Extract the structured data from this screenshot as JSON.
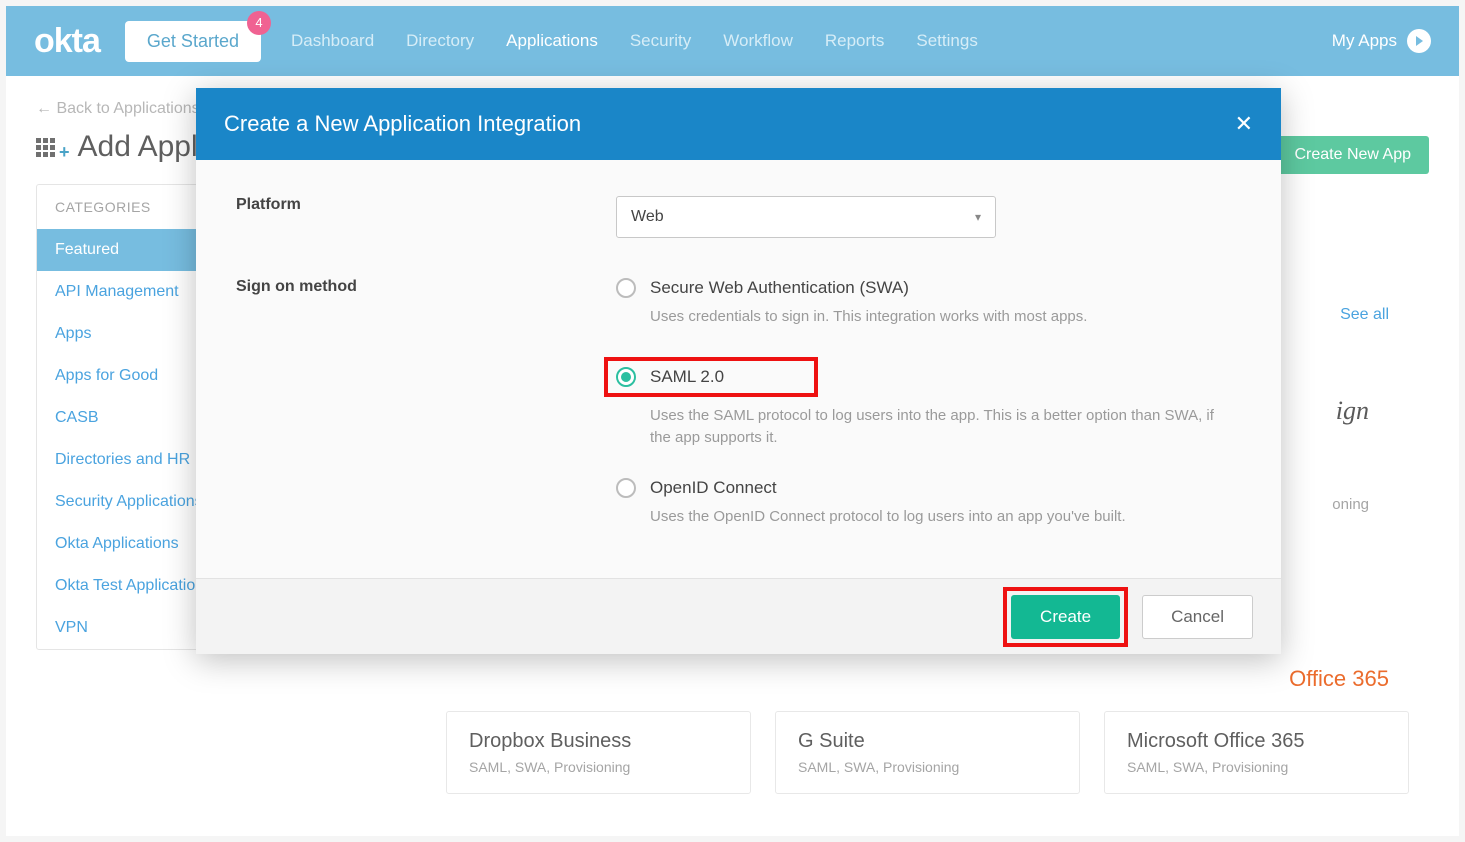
{
  "brand": "okta",
  "nav": {
    "getStarted": "Get Started",
    "badge": "4",
    "items": [
      "Dashboard",
      "Directory",
      "Applications",
      "Security",
      "Workflow",
      "Reports",
      "Settings"
    ],
    "activeIndex": 2,
    "myApps": "My Apps"
  },
  "page": {
    "backLink": "← Back to Applications",
    "title": "Add Application",
    "createNewApp": "Create New App",
    "seeAll": "See all"
  },
  "sidebar": {
    "header": "CATEGORIES",
    "items": [
      "Featured",
      "API Management",
      "Apps",
      "Apps for Good",
      "CASB",
      "Directories and HR",
      "Security Applications",
      "Okta Applications",
      "Okta Test Applications",
      "VPN"
    ],
    "selectedIndex": 0
  },
  "apps": [
    {
      "name": "Dropbox Business",
      "sub": "SAML, SWA, Provisioning"
    },
    {
      "name": "G Suite",
      "sub": "SAML, SWA, Provisioning"
    },
    {
      "name": "Microsoft Office 365",
      "sub": "SAML, SWA, Provisioning"
    }
  ],
  "partial": {
    "sign": "ign",
    "oning": "oning",
    "office": "Office 365"
  },
  "modal": {
    "title": "Create a New Application Integration",
    "platformLabel": "Platform",
    "platformValue": "Web",
    "signOnLabel": "Sign on method",
    "options": [
      {
        "label": "Secure Web Authentication (SWA)",
        "desc": "Uses credentials to sign in. This integration works with most apps.",
        "checked": false
      },
      {
        "label": "SAML 2.0",
        "desc": "Uses the SAML protocol to log users into the app. This is a better option than SWA, if the app supports it.",
        "checked": true
      },
      {
        "label": "OpenID Connect",
        "desc": "Uses the OpenID Connect protocol to log users into an app you've built.",
        "checked": false
      }
    ],
    "createBtn": "Create",
    "cancelBtn": "Cancel"
  }
}
